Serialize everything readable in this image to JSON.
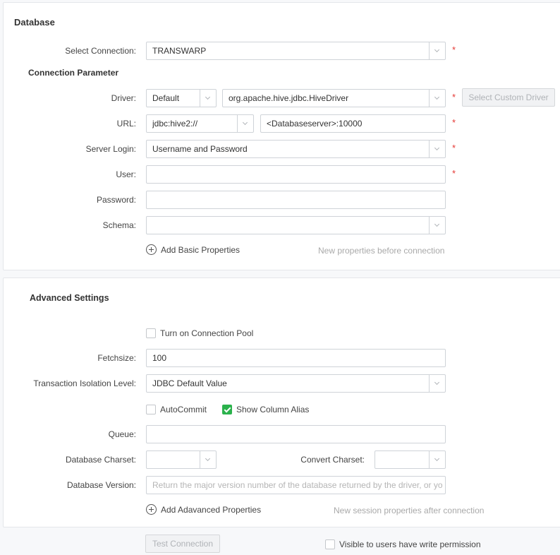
{
  "database": {
    "title": "Database",
    "select_connection": {
      "label": "Select Connection:",
      "value": "TRANSWARP"
    },
    "connection_parameter_title": "Connection Parameter",
    "driver": {
      "label": "Driver:",
      "type_value": "Default",
      "class_value": "org.apache.hive.jdbc.HiveDriver",
      "custom_button": "Select Custom Driver"
    },
    "url": {
      "label": "URL:",
      "prefix_value": "jdbc:hive2://",
      "host_value": "<Databaseserver>:10000"
    },
    "server_login": {
      "label": "Server Login:",
      "value": "Username and Password"
    },
    "user": {
      "label": "User:",
      "value": ""
    },
    "password": {
      "label": "Password:",
      "value": ""
    },
    "schema": {
      "label": "Schema:",
      "value": ""
    },
    "add_basic": "Add Basic Properties",
    "add_basic_hint": "New properties before connection",
    "required_mark": "*"
  },
  "advanced": {
    "title": "Advanced Settings",
    "connection_pool": {
      "label": "Turn on Connection Pool",
      "checked": false
    },
    "fetchsize": {
      "label": "Fetchsize:",
      "value": "100"
    },
    "isolation": {
      "label": "Transaction Isolation Level:",
      "value": "JDBC Default Value"
    },
    "autocommit": {
      "label": "AutoCommit",
      "checked": false
    },
    "show_alias": {
      "label": "Show Column Alias",
      "checked": true
    },
    "queue": {
      "label": "Queue:",
      "value": ""
    },
    "db_charset": {
      "label": "Database Charset:",
      "value": ""
    },
    "convert_charset": {
      "label": "Convert Charset:",
      "value": ""
    },
    "db_version": {
      "label": "Database Version:",
      "placeholder": "Return the major version number of the database returned by the driver, or you"
    },
    "add_advanced": "Add Adavanced Properties",
    "add_advanced_hint": "New session properties after connection"
  },
  "footer": {
    "test_connection": "Test Connection",
    "visible_write": {
      "label": "Visible to users have write permission",
      "checked": false
    }
  },
  "colors": {
    "required": "#e53935",
    "checkbox_on": "#2bb24c"
  }
}
